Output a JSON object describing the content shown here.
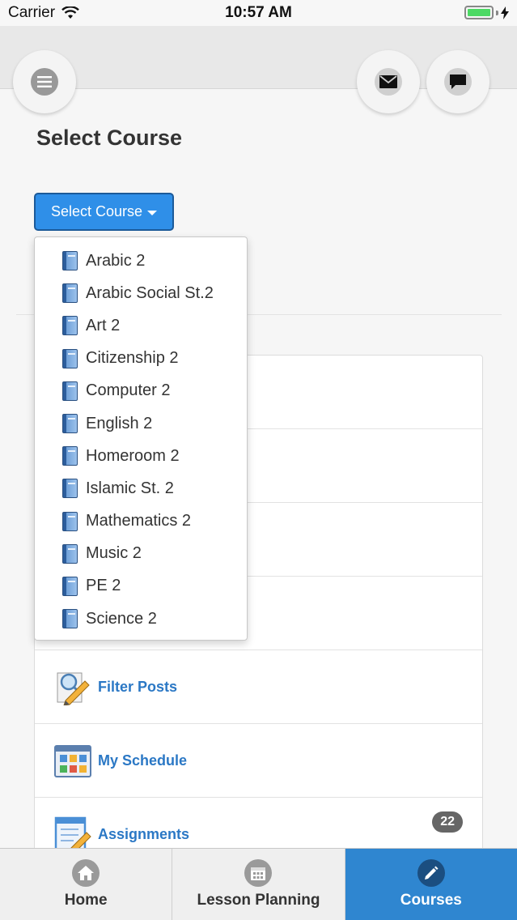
{
  "status_bar": {
    "carrier": "Carrier",
    "time": "10:57 AM"
  },
  "header": {
    "title": "Select Course"
  },
  "course_select": {
    "button_label": "Select Course",
    "options": [
      "Arabic 2",
      "Arabic Social St.2",
      "Art 2",
      "Citizenship 2",
      "Computer 2",
      "English 2",
      "Homeroom 2",
      "Islamic St. 2",
      "Mathematics 2",
      "Music 2",
      "PE 2",
      "Science 2"
    ]
  },
  "menu": {
    "filter_posts": "Filter Posts",
    "my_schedule": "My Schedule",
    "assignments": "Assignments",
    "assignments_count": "22"
  },
  "tabs": {
    "home": "Home",
    "lesson_planning": "Lesson Planning",
    "courses": "Courses",
    "active": "Courses"
  },
  "colors": {
    "accent": "#2f8fe8",
    "active_tab": "#2f86d0",
    "link": "#2b78c5"
  }
}
